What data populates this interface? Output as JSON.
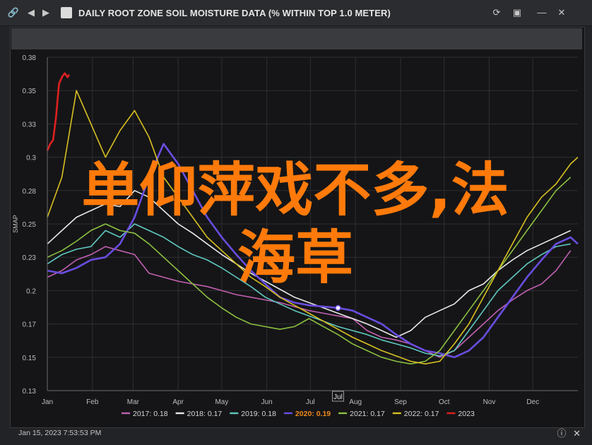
{
  "window": {
    "title": "DAILY ROOT ZONE SOIL MOISTURE DATA (% WITHIN TOP 1.0 METER)",
    "nav_icons": [
      "link-icon",
      "back-arrow-icon",
      "forward-arrow-icon"
    ],
    "control_icons": [
      "refresh-icon",
      "expand-icon",
      "minimize-icon",
      "close-icon"
    ]
  },
  "footer": {
    "date": "Jan 15, 2023 7:53:53 PM",
    "icons": [
      "info-icon",
      "close-icon"
    ]
  },
  "overlay_text": {
    "line1": "单仰萍戏不多,法",
    "line2": "海草"
  },
  "chart_data": {
    "type": "line",
    "xlabel": "",
    "ylabel": "SMAP",
    "ylim": [
      0.13,
      0.38
    ],
    "yticks": [
      "0.38",
      "0.35",
      "0.33",
      "0.3",
      "0.28",
      "0.25",
      "0.23",
      "0.2",
      "0.17",
      "0.15",
      "0.13"
    ],
    "ytick_values": [
      0.38,
      0.355,
      0.33,
      0.305,
      0.28,
      0.255,
      0.23,
      0.205,
      0.18,
      0.155,
      0.13
    ],
    "xlim": [
      0,
      365
    ],
    "xticks": [
      "Jan",
      "Feb",
      "Mar",
      "Apr",
      "May",
      "Jun",
      "Jul",
      "Aug",
      "Sep",
      "Oct",
      "Nov",
      "Dec"
    ],
    "xtick_days": [
      0,
      31,
      59,
      90,
      120,
      151,
      181,
      212,
      243,
      273,
      304,
      334
    ],
    "cursor_label": "Jul",
    "cursor_marker": {
      "day": 200,
      "value": 0.192
    },
    "grid": true,
    "legend_position": "bottom",
    "series": [
      {
        "name": "2017: 0.18",
        "color": "#c060b0",
        "x": [
          0,
          10,
          20,
          30,
          40,
          50,
          60,
          70,
          80,
          90,
          100,
          110,
          120,
          130,
          140,
          150,
          160,
          170,
          180,
          190,
          200,
          210,
          220,
          230,
          240,
          250,
          260,
          270,
          280,
          290,
          300,
          310,
          320,
          330,
          340,
          350,
          360
        ],
        "y": [
          0.215,
          0.22,
          0.228,
          0.232,
          0.238,
          0.235,
          0.232,
          0.218,
          0.215,
          0.212,
          0.21,
          0.208,
          0.205,
          0.202,
          0.2,
          0.198,
          0.196,
          0.193,
          0.19,
          0.188,
          0.186,
          0.184,
          0.175,
          0.17,
          0.168,
          0.165,
          0.16,
          0.155,
          0.16,
          0.17,
          0.18,
          0.19,
          0.198,
          0.205,
          0.21,
          0.22,
          0.235
        ]
      },
      {
        "name": "2018: 0.17",
        "color": "#e8e8e8",
        "x": [
          0,
          10,
          20,
          30,
          40,
          50,
          60,
          70,
          80,
          90,
          100,
          110,
          120,
          130,
          140,
          150,
          160,
          170,
          180,
          190,
          200,
          210,
          220,
          230,
          240,
          250,
          260,
          270,
          280,
          290,
          300,
          310,
          320,
          330,
          340,
          350,
          360
        ],
        "y": [
          0.24,
          0.25,
          0.26,
          0.265,
          0.27,
          0.268,
          0.28,
          0.275,
          0.265,
          0.255,
          0.248,
          0.24,
          0.232,
          0.225,
          0.218,
          0.212,
          0.206,
          0.2,
          0.196,
          0.192,
          0.188,
          0.184,
          0.18,
          0.175,
          0.17,
          0.175,
          0.185,
          0.19,
          0.195,
          0.205,
          0.21,
          0.22,
          0.228,
          0.235,
          0.24,
          0.245,
          0.25
        ]
      },
      {
        "name": "2019: 0.18",
        "color": "#5fc8c0",
        "x": [
          0,
          10,
          20,
          30,
          40,
          50,
          60,
          70,
          80,
          90,
          100,
          110,
          120,
          130,
          140,
          150,
          160,
          170,
          180,
          190,
          200,
          210,
          220,
          230,
          240,
          250,
          260,
          270,
          280,
          290,
          300,
          310,
          320,
          330,
          340,
          350,
          360
        ],
        "y": [
          0.225,
          0.232,
          0.236,
          0.238,
          0.25,
          0.245,
          0.255,
          0.25,
          0.245,
          0.238,
          0.232,
          0.228,
          0.222,
          0.215,
          0.208,
          0.2,
          0.195,
          0.19,
          0.186,
          0.182,
          0.178,
          0.175,
          0.172,
          0.168,
          0.165,
          0.162,
          0.158,
          0.156,
          0.16,
          0.175,
          0.19,
          0.205,
          0.215,
          0.225,
          0.232,
          0.238,
          0.24
        ]
      },
      {
        "name": "2020: 0.19",
        "color": "#6a4de0",
        "x": [
          0,
          10,
          20,
          30,
          40,
          50,
          60,
          70,
          80,
          90,
          100,
          110,
          120,
          130,
          140,
          150,
          160,
          170,
          180,
          190,
          200,
          210,
          220,
          230,
          240,
          250,
          260,
          270,
          280,
          290,
          300,
          310,
          320,
          330,
          340,
          350,
          360,
          365
        ],
        "y": [
          0.22,
          0.218,
          0.222,
          0.228,
          0.23,
          0.24,
          0.26,
          0.29,
          0.315,
          0.3,
          0.28,
          0.26,
          0.245,
          0.232,
          0.22,
          0.21,
          0.2,
          0.196,
          0.194,
          0.193,
          0.192,
          0.19,
          0.185,
          0.18,
          0.172,
          0.165,
          0.16,
          0.158,
          0.155,
          0.16,
          0.17,
          0.185,
          0.2,
          0.215,
          0.228,
          0.24,
          0.245,
          0.24
        ]
      },
      {
        "name": "2021: 0.17",
        "color": "#8cc040",
        "x": [
          0,
          10,
          20,
          30,
          40,
          50,
          60,
          70,
          80,
          90,
          100,
          110,
          120,
          130,
          140,
          150,
          160,
          170,
          180,
          190,
          200,
          210,
          220,
          230,
          240,
          250,
          260,
          270,
          280,
          290,
          300,
          310,
          320,
          330,
          340,
          350,
          360
        ],
        "y": [
          0.23,
          0.235,
          0.242,
          0.25,
          0.255,
          0.25,
          0.248,
          0.24,
          0.23,
          0.22,
          0.21,
          0.2,
          0.192,
          0.185,
          0.18,
          0.178,
          0.176,
          0.178,
          0.184,
          0.178,
          0.172,
          0.165,
          0.16,
          0.155,
          0.152,
          0.15,
          0.152,
          0.16,
          0.175,
          0.19,
          0.205,
          0.22,
          0.235,
          0.25,
          0.265,
          0.28,
          0.29
        ]
      },
      {
        "name": "2022: 0.17",
        "color": "#d8c020",
        "x": [
          0,
          10,
          20,
          30,
          40,
          50,
          60,
          70,
          80,
          90,
          100,
          110,
          120,
          130,
          140,
          150,
          160,
          170,
          180,
          190,
          200,
          210,
          220,
          230,
          240,
          250,
          260,
          270,
          280,
          290,
          300,
          310,
          320,
          330,
          340,
          350,
          360,
          365
        ],
        "y": [
          0.26,
          0.29,
          0.355,
          0.33,
          0.305,
          0.325,
          0.34,
          0.32,
          0.29,
          0.275,
          0.26,
          0.245,
          0.235,
          0.225,
          0.215,
          0.208,
          0.2,
          0.194,
          0.188,
          0.182,
          0.176,
          0.17,
          0.165,
          0.16,
          0.156,
          0.152,
          0.15,
          0.152,
          0.165,
          0.18,
          0.2,
          0.22,
          0.24,
          0.26,
          0.275,
          0.285,
          0.3,
          0.305
        ]
      },
      {
        "name": "2023",
        "color": "#e02020",
        "x": [
          0,
          2,
          4,
          6,
          8,
          10,
          12,
          14,
          15
        ],
        "y": [
          0.31,
          0.315,
          0.318,
          0.335,
          0.36,
          0.365,
          0.368,
          0.365,
          0.367
        ]
      }
    ]
  }
}
